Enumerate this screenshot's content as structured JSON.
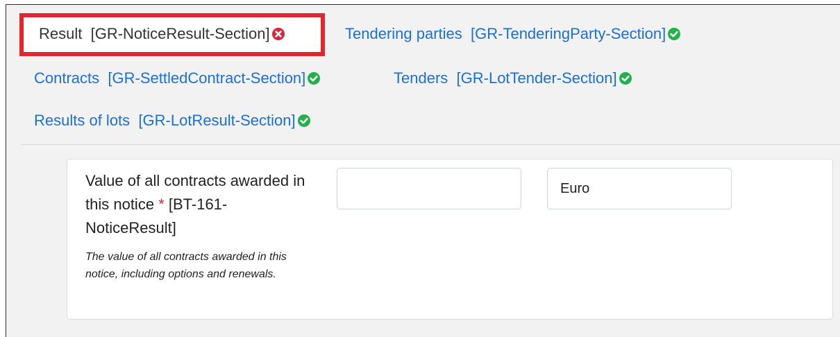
{
  "tabs": [
    {
      "label": "Result",
      "code": "[GR-NoticeResult-Section]",
      "status": "error",
      "active": true
    },
    {
      "label": "Tendering parties",
      "code": "[GR-TenderingParty-Section]",
      "status": "valid",
      "active": false
    },
    {
      "label": "Contracts",
      "code": "[GR-SettledContract-Section]",
      "status": "valid",
      "active": false
    },
    {
      "label": "Tenders",
      "code": "[GR-LotTender-Section]",
      "status": "valid",
      "active": false
    },
    {
      "label": "Results of lots",
      "code": "[GR-LotResult-Section]",
      "status": "valid",
      "active": false
    }
  ],
  "field": {
    "label_part1": "Value of all contracts awarded in this notice",
    "required_mark": "*",
    "label_code": "[BT-161-NoticeResult]",
    "hint": "The value of all contracts awarded in this notice, including options and renewals.",
    "amount_value": "",
    "currency_value": "Euro"
  },
  "colors": {
    "link": "#1a6fe0",
    "error_icon": "#d7263d",
    "valid_icon": "#22b14c",
    "active_highlight": "#e3262d"
  },
  "icons": {
    "error": "x-circle-icon",
    "valid": "check-circle-icon"
  }
}
